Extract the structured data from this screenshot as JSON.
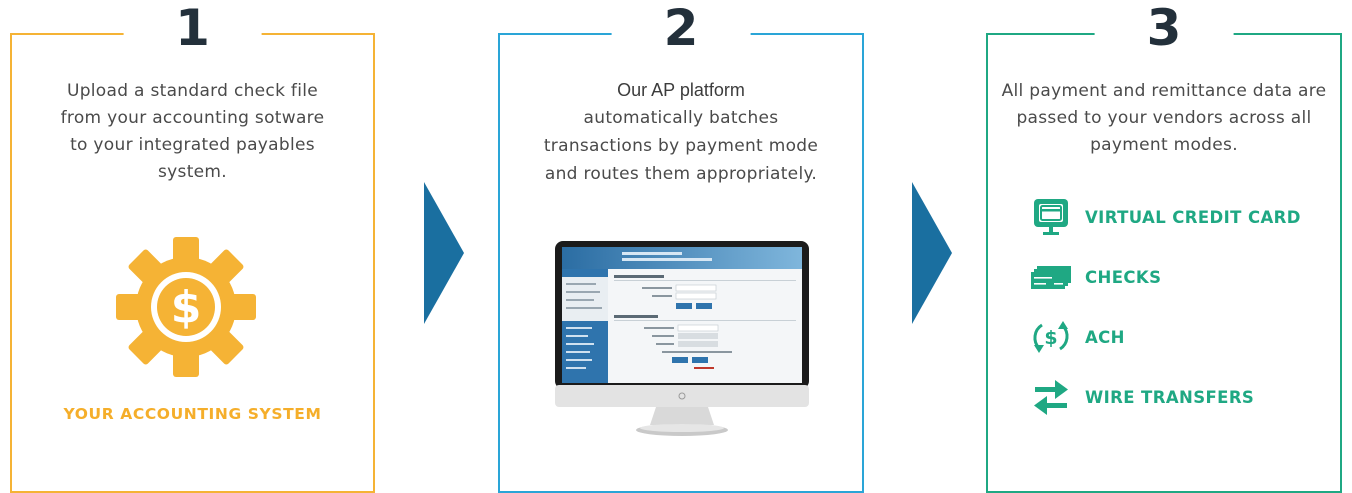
{
  "steps": [
    {
      "number": "1",
      "description": "Upload a standard check file from your accounting sotware to your integrated payables system.",
      "icon": "gear-dollar-icon",
      "label": "YOUR ACCOUNTING SYSTEM"
    },
    {
      "number": "2",
      "description_lead": "Our AP platform",
      "description_rest": "automatically batches transactions by payment mode and routes them appropriately.",
      "icon": "monitor-screenshot"
    },
    {
      "number": "3",
      "description": "All payment and remittance data are passed to your vendors across all payment modes.",
      "modes": [
        {
          "label": "VIRTUAL CREDIT CARD",
          "icon": "credit-card-monitor-icon"
        },
        {
          "label": "CHECKS",
          "icon": "checks-icon"
        },
        {
          "label": "ACH",
          "icon": "ach-dollar-cycle-icon"
        },
        {
          "label": "WIRE TRANSFERS",
          "icon": "wire-transfer-arrows-icon"
        }
      ]
    }
  ],
  "colors": {
    "step1": "#f5b335",
    "step2": "#2aa5d7",
    "step3": "#1fa883",
    "arrow": "#1a6fa0",
    "number": "#23303b"
  }
}
